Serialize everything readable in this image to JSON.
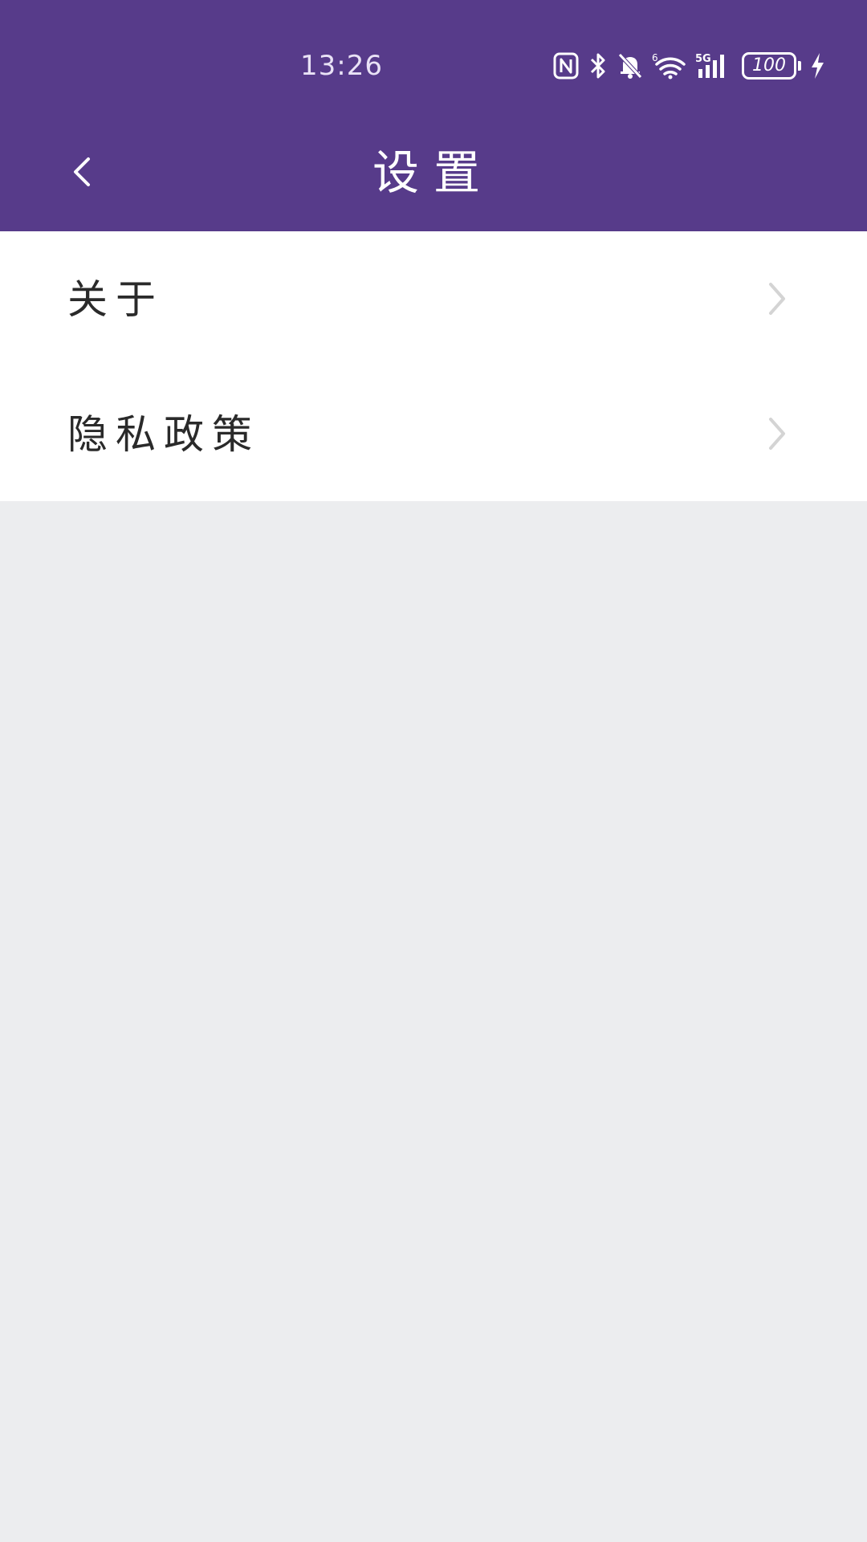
{
  "status_bar": {
    "time": "13:26",
    "battery_level": "100",
    "icons": [
      "nfc-icon",
      "bluetooth-icon",
      "mute-bell-icon",
      "wifi-6-icon",
      "signal-5g-icon",
      "battery-icon",
      "charging-bolt-icon"
    ]
  },
  "nav": {
    "title": "设置",
    "back_icon": "chevron-left-icon"
  },
  "menu": {
    "items": [
      {
        "label": "关于",
        "icon": "chevron-right-icon"
      },
      {
        "label": "隐私政策",
        "icon": "chevron-right-icon"
      }
    ]
  },
  "colors": {
    "header": "#573b8a",
    "page_background": "#ecedef",
    "list_background": "#ffffff",
    "label_text": "#2a2a2a",
    "chevron": "#d4d4d4"
  }
}
